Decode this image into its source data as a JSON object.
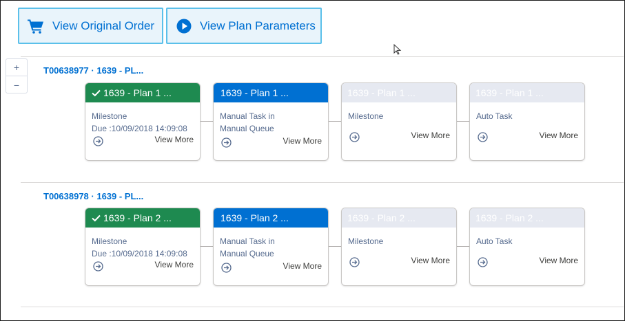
{
  "toolbar": {
    "view_original_order": "View Original Order",
    "view_plan_parameters": "View Plan Parameters"
  },
  "zoom": {
    "zoom_in": "+",
    "zoom_out": "−"
  },
  "colors": {
    "done": "#1e8a50",
    "active": "#0070d2",
    "pending": "#e6e9f1",
    "link": "#0070d2"
  },
  "orders": [
    {
      "id_label": "T00638977 · 1639 - PL...",
      "tasks": [
        {
          "status": "done",
          "title": "1639 - Plan 1 ...",
          "type": "Milestone",
          "due": "Due :10/09/2018 14:09:08",
          "view_more": "View More"
        },
        {
          "status": "active",
          "title": "1639 - Plan 1 ...",
          "type_line1": "Manual Task in",
          "type_line2": "Manual Queue",
          "view_more": "View More"
        },
        {
          "status": "pending",
          "title": "1639 - Plan 1 ...",
          "type": "Milestone",
          "view_more": "View More"
        },
        {
          "status": "pending",
          "title": "1639 - Plan 1 ...",
          "type": "Auto Task",
          "view_more": "View More"
        }
      ]
    },
    {
      "id_label": "T00638978 · 1639 - PL...",
      "tasks": [
        {
          "status": "done",
          "title": "1639 - Plan 2 ...",
          "type": "Milestone",
          "due": "Due :10/09/2018 14:09:08",
          "view_more": "View More"
        },
        {
          "status": "active",
          "title": "1639 - Plan 2 ...",
          "type_line1": "Manual Task in",
          "type_line2": "Manual Queue",
          "view_more": "View More"
        },
        {
          "status": "pending",
          "title": "1639 - Plan 2 ...",
          "type": "Milestone",
          "view_more": "View More"
        },
        {
          "status": "pending",
          "title": "1639 - Plan 2 ...",
          "type": "Auto Task",
          "view_more": "View More"
        }
      ]
    }
  ]
}
